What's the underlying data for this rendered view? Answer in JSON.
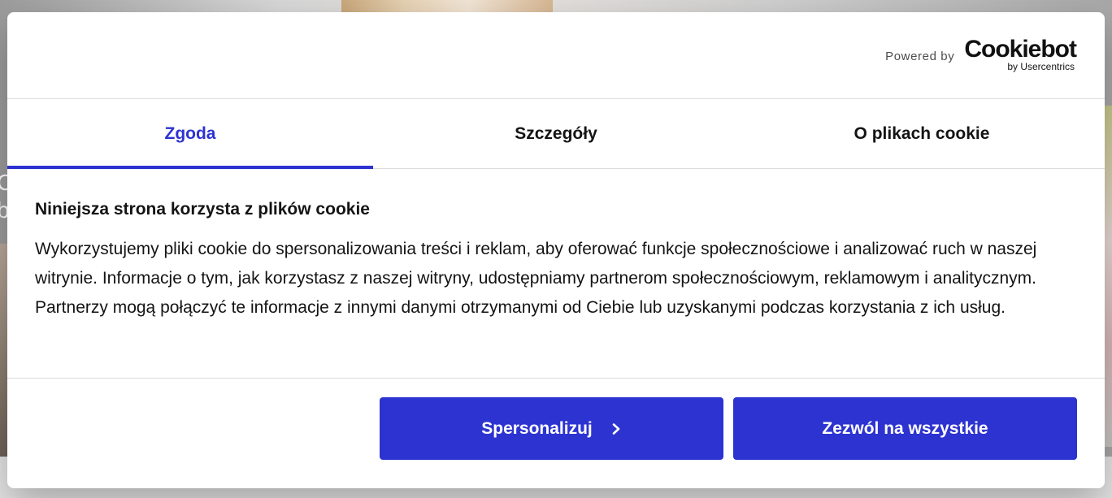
{
  "background": {
    "left_text_line1": "C",
    "left_text_line2": "b"
  },
  "header": {
    "powered_by": "Powered by",
    "logo_word": "Cookiebot",
    "logo_sub": "by Usercentrics"
  },
  "tabs": [
    {
      "label": "Zgoda",
      "active": true
    },
    {
      "label": "Szczegóły",
      "active": false
    },
    {
      "label": "O plikach cookie",
      "active": false
    }
  ],
  "content": {
    "title": "Niniejsza strona korzysta z plików cookie",
    "text": "Wykorzystujemy pliki cookie do spersonalizowania treści i reklam, aby oferować funkcje społecznościowe i analizować ruch w naszej witrynie. Informacje o tym, jak korzystasz z naszej witryny, udostępniamy partnerom społecznościowym, reklamowym i analitycznym. Partnerzy mogą połączyć te informacje z innymi danymi otrzymanymi od Ciebie lub uzyskanymi podczas korzystania z ich usług."
  },
  "buttons": {
    "personalize": "Spersonalizuj",
    "personalize_icon": "chevron-right-icon",
    "allow_all": "Zezwól na wszystkie"
  },
  "colors": {
    "accent": "#2d33d1",
    "text": "#141414",
    "divider": "#dcdcdc"
  }
}
